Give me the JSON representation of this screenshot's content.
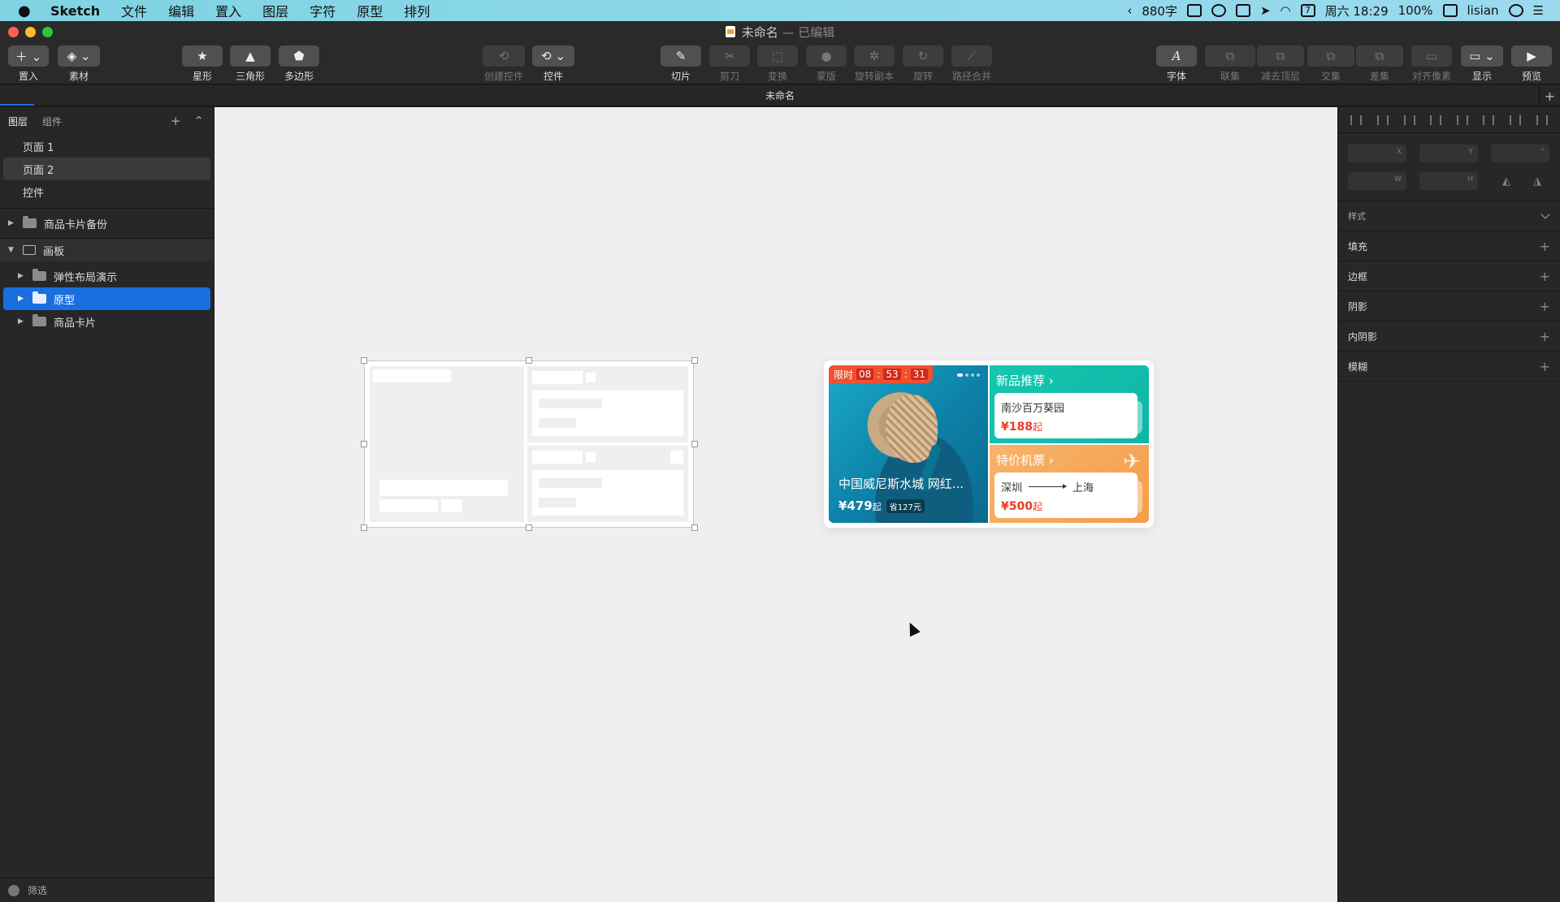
{
  "menubar": {
    "apple": "",
    "items": [
      "Sketch",
      "文件",
      "编辑",
      "置入",
      "图层",
      "字符",
      "原型",
      "排列"
    ],
    "status": {
      "word_count": "880字",
      "datetime": "周六 18:29",
      "calendar_day": "7",
      "battery": "100%",
      "user": "lisian"
    }
  },
  "window": {
    "title": "未命名",
    "subtitle": "— 已编辑"
  },
  "toolbar": {
    "insert": "置入",
    "material": "素材",
    "star": "星形",
    "triangle": "三角形",
    "polygon": "多边形",
    "create_symbol": "创建控件",
    "symbol": "控件",
    "slice": "切片",
    "scissors": "剪刀",
    "transform": "变换",
    "mask": "蒙版",
    "rotate_copies": "旋转副本",
    "rotate": "旋转",
    "path_combine": "路径合并",
    "font": "字体",
    "union": "联集",
    "subtract": "减去顶层",
    "intersect": "交集",
    "difference": "差集",
    "pixel_align": "对齐像素",
    "display": "显示",
    "preview": "预览"
  },
  "doc_tab": {
    "title": "未命名"
  },
  "left_panel": {
    "tabs": [
      "图层",
      "组件"
    ],
    "pages": [
      "页面 1",
      "页面 2",
      "控件"
    ],
    "layers": {
      "backup": "商品卡片备份",
      "artboard": "画板",
      "children": [
        "弹性布局演示",
        "原型",
        "商品卡片"
      ]
    },
    "filter": "筛选"
  },
  "card": {
    "timer_label": "限时",
    "timer": [
      "08",
      "53",
      "31"
    ],
    "destination": "中国威尼斯水城 网红...",
    "price": "¥479",
    "price_suffix": "起",
    "save": "省127元",
    "new_title": "新品推荐 ›",
    "new_item": "南沙百万葵园",
    "new_price": "¥188",
    "new_price_suffix": "起",
    "flight_title": "特价机票 ›",
    "from": "深圳",
    "to": "上海",
    "flight_price": "¥500",
    "flight_price_suffix": "起"
  },
  "inspector": {
    "x": "X",
    "y": "Y",
    "w": "W",
    "h": "H",
    "deg": "°",
    "style": "样式",
    "fill": "填充",
    "border": "边框",
    "shadow": "阴影",
    "inner_shadow": "内阴影",
    "blur": "模糊"
  },
  "colors": {
    "selection": "#1a6fe0",
    "canvas": "#efeff1",
    "teal": "#14c7b0",
    "orange": "#f59d4b",
    "red": "#f0512f"
  }
}
